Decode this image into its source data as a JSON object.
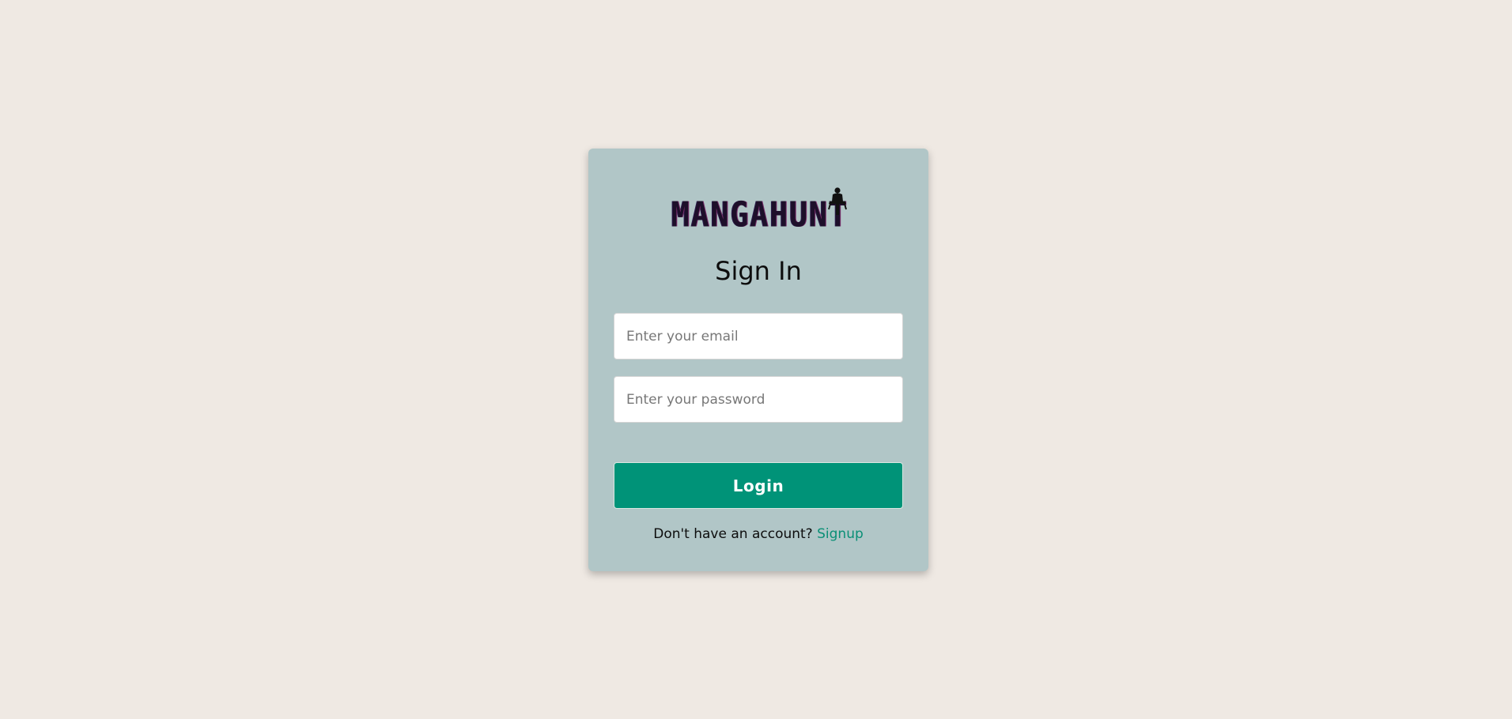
{
  "brand": {
    "logo_text": "MANGAHUNT"
  },
  "form": {
    "title": "Sign In",
    "email_placeholder": "Enter your email",
    "password_placeholder": "Enter your password",
    "login_label": "Login",
    "signup_prompt": "Don't have an account?",
    "signup_link": "Signup"
  },
  "colors": {
    "page_background": "#efe9e3",
    "card_background": "#b1c6c7",
    "accent": "#009378",
    "link": "#0a8f76"
  }
}
